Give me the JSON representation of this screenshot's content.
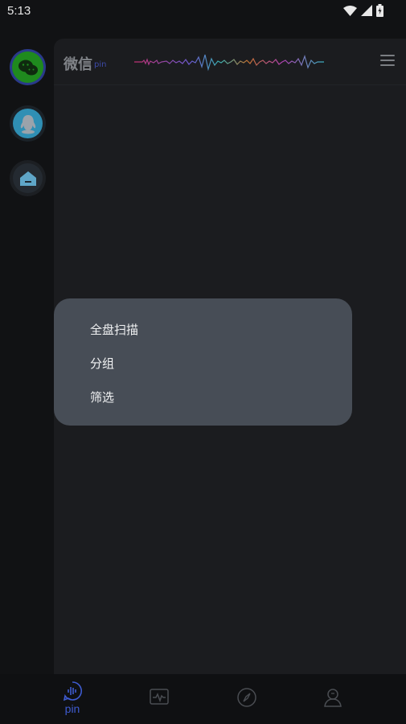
{
  "status_bar": {
    "time": "5:13"
  },
  "rail": {
    "items": [
      {
        "icon": "wechat-icon"
      },
      {
        "icon": "qq-icon"
      },
      {
        "icon": "home-icon"
      }
    ]
  },
  "header": {
    "title": "微信",
    "subtitle": "pin",
    "menu_icon": "hamburger-menu-icon"
  },
  "popup_menu": {
    "items": [
      "全盘扫描",
      "分组",
      "筛选"
    ]
  },
  "bottom_nav": {
    "items": [
      {
        "icon": "voice-pin-icon",
        "label": "pin",
        "active": true
      },
      {
        "icon": "activity-monitor-icon",
        "label": ""
      },
      {
        "icon": "compass-icon",
        "label": ""
      },
      {
        "icon": "profile-icon",
        "label": ""
      }
    ]
  },
  "colors": {
    "accent": "#3e5bd0",
    "popup_bg": "#474d56",
    "panel_bg": "#1b1c1f",
    "background": "#111214"
  }
}
